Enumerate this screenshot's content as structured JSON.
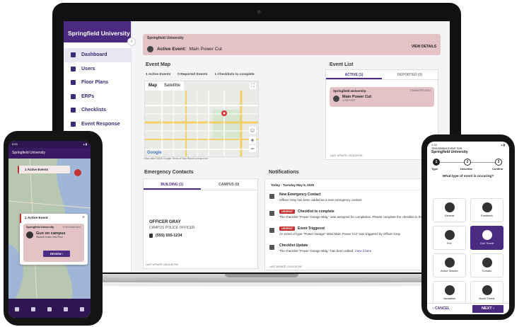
{
  "laptop": {
    "sidebar": {
      "org_name": "Springfield University",
      "items": [
        {
          "label": "Dashboard"
        },
        {
          "label": "Users"
        },
        {
          "label": "Floor Plans"
        },
        {
          "label": "ERPs"
        },
        {
          "label": "Checklists"
        },
        {
          "label": "Event Response"
        }
      ]
    },
    "banner": {
      "org": "Springfield University",
      "event_label": "Active Event:",
      "event_name": "Main Power Cut",
      "link": "VIEW DETAILS"
    },
    "event_map": {
      "title": "Event Map",
      "stats": {
        "active": "1 Active Events",
        "reported": "0 Reported Events",
        "checklists": "1 Checklists to complete"
      },
      "tabs": {
        "map": "Map",
        "satellite": "Satellite"
      },
      "google": "Google",
      "footer": "Map data ©2020 Google   Terms of Use   Report a map error"
    },
    "event_list": {
      "title": "Event List",
      "tabs": {
        "active": "ACTIVE (1)",
        "reported": "REPORTED (0)"
      },
      "card": {
        "org": "Springfield University",
        "time": "2 MINUTES AGO",
        "title": "Main Power Cut",
        "count": "1 REPORT"
      },
      "footer": "LAST UPDATE: 03:03:30 PM"
    },
    "contacts": {
      "title": "Emergency Contacts",
      "tabs": {
        "building": "BUILDING (1)",
        "campus": "CAMPUS (0)"
      },
      "name": "OFFICER GRAY",
      "role": "CAMPUS POLICE OFFICER",
      "phone": "(555) 555-1234",
      "footer": "LAST UPDATE: 03:03:30 PM"
    },
    "notifications": {
      "title": "Notifications",
      "date": "Today - Tuesday May 5, 2020",
      "items": [
        {
          "title": "New Emergency Contact",
          "tag": "",
          "body": "Officer Gray has been added as a new emergency contact."
        },
        {
          "title": "Checklist to complete",
          "tag": "URGENT",
          "body": "The checklist \"Power Outage Bldg.\" was assigned for completion. Please complete the checklist in the mobile app."
        },
        {
          "title": "Event Triggered",
          "tag": "URGENT",
          "body": "An event of type \"Power Outage\" titled Main Power Cut\" was triggered by Officer Gray"
        },
        {
          "title": "Checklist Update",
          "tag": "",
          "body": "The checklist \"Power Outage Bldg.\" has been edited.",
          "link": "View it here"
        }
      ],
      "footer": "LAST UPDATE: 03:03:30 PM"
    }
  },
  "phone_left": {
    "time": "8:53",
    "app_title": "Springfield University",
    "chip": "1 Active Events",
    "popup": {
      "header": "1 Active Event",
      "close": "×",
      "org": "Springfield University",
      "time": "5 SECONDS AGO",
      "title": "Gun on campus",
      "sub": "Student Union 2nd Floor",
      "button": "REVIEW  ›"
    }
  },
  "phone_right": {
    "time": "1:23",
    "small_header": "TRIGGERING EVENT FOR",
    "org": "Springfield University",
    "steps": [
      {
        "num": "1",
        "label": "Type"
      },
      {
        "num": "2",
        "label": "Describe"
      },
      {
        "num": "3",
        "label": "Confirm"
      }
    ],
    "question": "What type of event is occuring?",
    "tiles": [
      {
        "label": "General",
        "icon": "general-icon"
      },
      {
        "label": "Pandemic",
        "icon": "pandemic-icon"
      },
      {
        "label": "Fire",
        "icon": "fire-icon"
      },
      {
        "label": "Gun Threat",
        "icon": "gun-icon",
        "selected": true
      },
      {
        "label": "Active Shooter",
        "icon": "target-icon"
      },
      {
        "label": "Tornado",
        "icon": "tornado-icon"
      },
      {
        "label": "Vandalism",
        "icon": "vandalism-icon"
      },
      {
        "label": "Bomb Threat",
        "icon": "bomb-icon"
      }
    ],
    "cancel": "‹  CANCEL",
    "next": "NEXT  ›"
  },
  "colors": {
    "brand": "#4b2a82",
    "alert_bg": "#e3c3c6",
    "urgent": "#c43232"
  }
}
